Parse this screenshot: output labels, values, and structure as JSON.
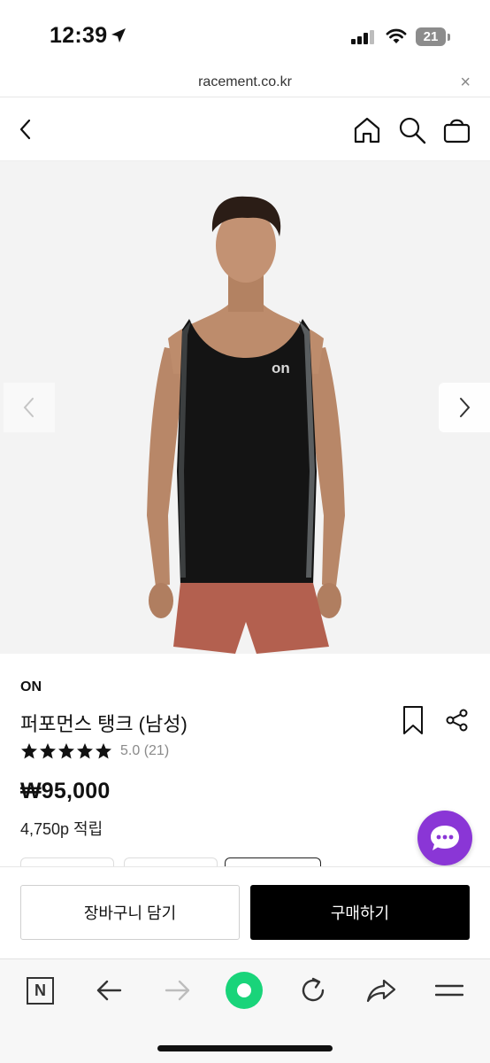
{
  "status_bar": {
    "time": "12:39",
    "battery": "21",
    "icons": [
      "location-arrow-icon",
      "signal-icon",
      "wifi-icon",
      "battery-icon"
    ]
  },
  "browser": {
    "url": "racement.co.kr",
    "close_label": "×"
  },
  "header": {
    "icons": [
      "back-icon",
      "home-icon",
      "search-icon",
      "shopping-bag-icon"
    ]
  },
  "product": {
    "brand": "ON",
    "name": "퍼포먼스 탱크 (남성)",
    "rating": "5.0 (21)",
    "stars": 5,
    "price": "₩95,000",
    "points": "4,750p 적립",
    "logo_text": "on"
  },
  "actions": {
    "cart_label": "장바구니 담기",
    "buy_label": "구매하기"
  },
  "toolbar": {
    "icons": [
      "naver-n-icon",
      "back-arrow-icon",
      "forward-arrow-icon",
      "green-dot-icon",
      "refresh-icon",
      "share-arrow-icon",
      "menu-icon"
    ],
    "n_label": "N"
  },
  "colors": {
    "chat_accent": "#8a36d6",
    "green_dot": "#19d47a",
    "buy_button": "#000000"
  }
}
